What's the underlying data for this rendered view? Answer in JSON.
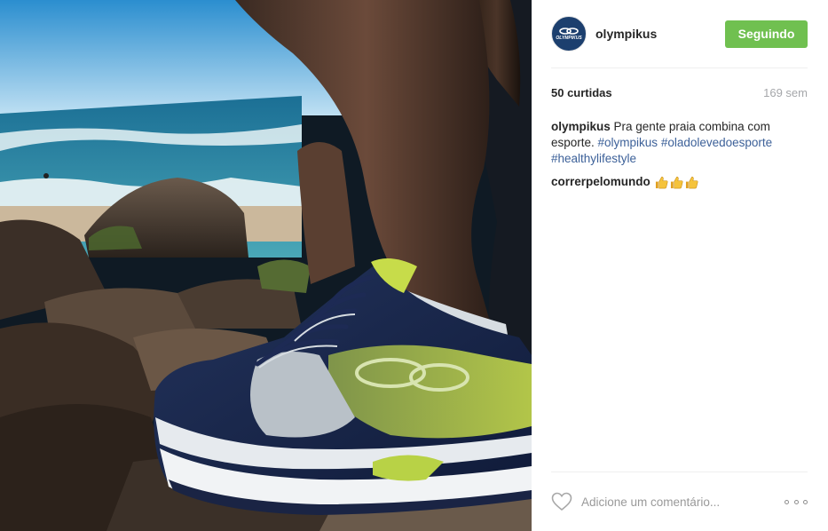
{
  "post": {
    "photo": {
      "description_icon": "photo-icon"
    }
  },
  "header": {
    "avatar_text": "OLYMPIKUS",
    "username": "olympikus",
    "follow_label": "Seguindo",
    "follow_color": "#70c050"
  },
  "stats": {
    "likes": "50 curtidas",
    "time": "169 sem"
  },
  "caption": {
    "author": "olympikus",
    "text": " Pra gente praia combina com esporte. ",
    "hashtags": [
      "#olympikus",
      "#oladolevedoesporte",
      "#healthylifestyle"
    ]
  },
  "comments": [
    {
      "author": "correrpelomundo",
      "emoji": [
        "thumbs-up-icon",
        "thumbs-up-icon",
        "thumbs-up-icon"
      ]
    }
  ],
  "footer": {
    "like_icon": "heart-icon",
    "comment_placeholder": "Adicione um comentário...",
    "more_icon": "more-options-icon"
  },
  "colors": {
    "hashtag": "#3d6199",
    "muted": "#a5a7aa",
    "brand_avatar": "#1c3f6e"
  }
}
